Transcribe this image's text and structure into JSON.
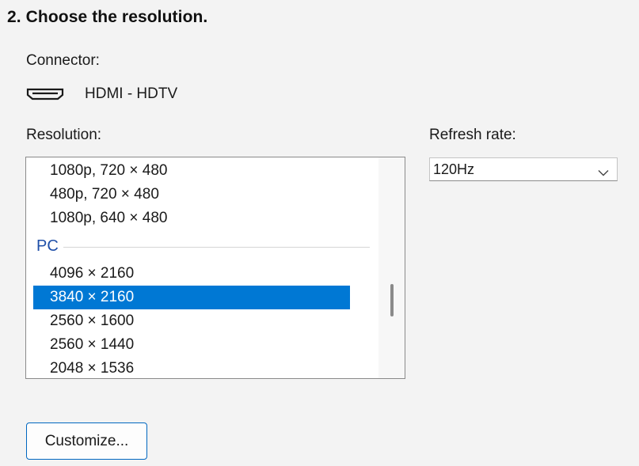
{
  "step_title": "2. Choose the resolution.",
  "connector": {
    "label": "Connector:",
    "icon": "hdmi-port-icon",
    "value": "HDMI - HDTV"
  },
  "resolution": {
    "label": "Resolution:",
    "items_top": [
      "1080p, 720 × 480",
      "480p, 720 × 480",
      "1080p, 640 × 480"
    ],
    "group_header": "PC",
    "items_pc": [
      "4096 × 2160",
      "3840 × 2160",
      "2560 × 1600",
      "2560 × 1440",
      "2048 × 1536"
    ],
    "selected": "3840 × 2160",
    "selected_color": "#0078d4"
  },
  "refresh_rate": {
    "label": "Refresh rate:",
    "value": "120Hz",
    "icon": "chevron-down-icon"
  },
  "buttons": {
    "customize": "Customize..."
  }
}
